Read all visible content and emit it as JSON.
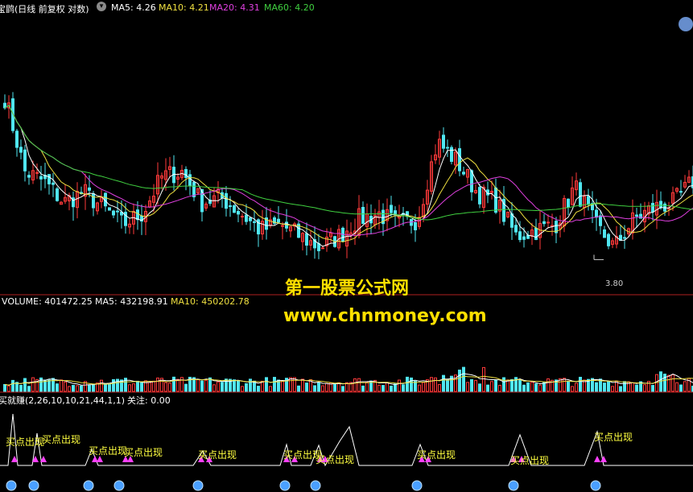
{
  "price_header": {
    "title": "宝鹍(日线 前复权 对数)",
    "ma5": "MA5: 4.26",
    "ma10": "MA10: 4.21",
    "ma20": "MA20: 4.31",
    "ma60": "MA60: 4.20",
    "low_label": "3.80"
  },
  "volume_header": {
    "volume": "VOLUME: 401472.25",
    "ma5": "MA5: 432198.91",
    "ma10": "MA10: 450202.78"
  },
  "indicator_header": {
    "name": "买就赚(2,26,10,10,21,44,1,1)",
    "focus": "关注: 0.00"
  },
  "watermark": {
    "line1": "第一股票公式网",
    "line2": "www.chnmoney.com"
  },
  "signal_labels": [
    "买点出现",
    "买点出现",
    "买点出现",
    "买点出现",
    "买点出现",
    "买点出现",
    "买点出现",
    "买点出现",
    "买点出现",
    "买点出现"
  ],
  "colors": {
    "up": "#ff3a3a",
    "down": "#50e6f0",
    "ma5": "#ffffff",
    "ma10": "#f0e040",
    "ma20": "#e040e0",
    "ma60": "#40d040",
    "indicator_line": "#ffffff",
    "signal_text": "#ffff40",
    "arrow": "#ff40ff",
    "ball": "#4aa0ff"
  },
  "chart_data": {
    "type": "candlestick",
    "panels": [
      "price",
      "volume",
      "indicator"
    ],
    "price_axis": {
      "scale": "log",
      "visible_low": 3.8
    },
    "moving_averages": {
      "MA5": 4.26,
      "MA10": 4.21,
      "MA20": 4.31,
      "MA60": 4.2
    },
    "last_volume": 401472.25,
    "volume_ma5": 432198.91,
    "volume_ma10": 450202.78,
    "indicator_focus": 0.0,
    "trend_samples": {
      "note": "approximate closing-price path across the visible bars",
      "close": [
        5.4,
        4.6,
        4.5,
        4.3,
        4.4,
        4.25,
        4.1,
        4.2,
        4.55,
        4.6,
        4.3,
        4.35,
        4.2,
        4.05,
        4.1,
        4.0,
        3.9,
        4.0,
        4.15,
        4.2,
        4.1,
        4.15,
        4.9,
        4.7,
        4.4,
        4.3,
        4.0,
        4.05,
        4.1,
        4.45,
        4.1,
        3.9,
        4.15,
        4.25,
        4.3,
        4.5
      ]
    }
  }
}
